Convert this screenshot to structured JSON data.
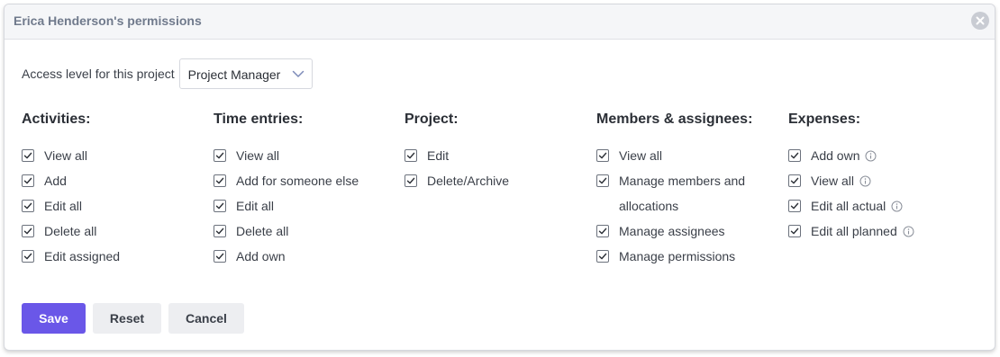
{
  "dialog": {
    "title": "Erica Henderson's permissions"
  },
  "access": {
    "label": "Access level for this project",
    "selected": "Project Manager"
  },
  "columns": [
    {
      "title": "Activities:",
      "items": [
        {
          "label": "View all",
          "checked": true
        },
        {
          "label": "Add",
          "checked": true
        },
        {
          "label": "Edit all",
          "checked": true
        },
        {
          "label": "Delete all",
          "checked": true
        },
        {
          "label": "Edit assigned",
          "checked": true
        }
      ]
    },
    {
      "title": "Time entries:",
      "items": [
        {
          "label": "View all",
          "checked": true
        },
        {
          "label": "Add for someone else",
          "checked": true
        },
        {
          "label": "Edit all",
          "checked": true
        },
        {
          "label": "Delete all",
          "checked": true
        },
        {
          "label": "Add own",
          "checked": true
        }
      ]
    },
    {
      "title": "Project:",
      "items": [
        {
          "label": "Edit",
          "checked": true
        },
        {
          "label": "Delete/Archive",
          "checked": true
        }
      ]
    },
    {
      "title": "Members & assignees:",
      "items": [
        {
          "label": "View all",
          "checked": true
        },
        {
          "label": "Manage members and allocations",
          "checked": true
        },
        {
          "label": "Manage assignees",
          "checked": true
        },
        {
          "label": "Manage permissions",
          "checked": true
        }
      ]
    },
    {
      "title": "Expenses:",
      "items": [
        {
          "label": "Add own",
          "checked": true,
          "info": true
        },
        {
          "label": "View all",
          "checked": true,
          "info": true
        },
        {
          "label": "Edit all actual",
          "checked": true,
          "info": true
        },
        {
          "label": "Edit all planned",
          "checked": true,
          "info": true
        }
      ]
    }
  ],
  "buttons": {
    "save": "Save",
    "reset": "Reset",
    "cancel": "Cancel"
  },
  "colors": {
    "primary": "#6a57e8",
    "secondary_button": "#edeef1",
    "header_bg": "#f5f6f8",
    "title_text": "#707a8c"
  }
}
